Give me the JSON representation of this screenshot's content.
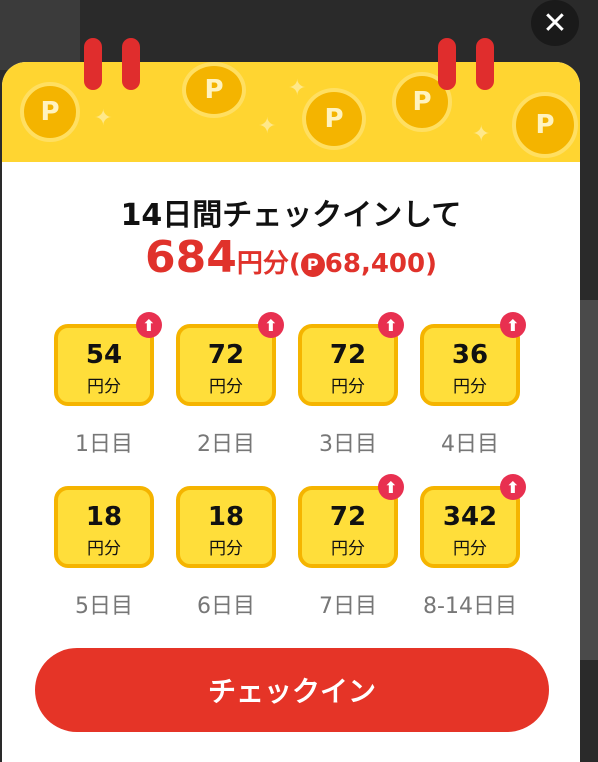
{
  "close_button": {
    "icon": "close-icon",
    "glyph": "✕"
  },
  "header": {
    "coin_glyph": "P",
    "sparkle_glyph": "✦"
  },
  "title": "14日間チェックインして",
  "amount": {
    "value": "684",
    "unit": "円分",
    "open_paren": "(",
    "points_icon": "P",
    "points": "68,400",
    "close_paren": ")"
  },
  "days": [
    {
      "value": "54",
      "unit": "円分",
      "label": "1日目",
      "boosted": true
    },
    {
      "value": "72",
      "unit": "円分",
      "label": "2日目",
      "boosted": true
    },
    {
      "value": "72",
      "unit": "円分",
      "label": "3日目",
      "boosted": true
    },
    {
      "value": "36",
      "unit": "円分",
      "label": "4日目",
      "boosted": true
    },
    {
      "value": "18",
      "unit": "円分",
      "label": "5日目",
      "boosted": false
    },
    {
      "value": "18",
      "unit": "円分",
      "label": "6日目",
      "boosted": false
    },
    {
      "value": "72",
      "unit": "円分",
      "label": "7日目",
      "boosted": true
    },
    {
      "value": "342",
      "unit": "円分",
      "label": "8-14日目",
      "boosted": true
    }
  ],
  "up_glyph": "⬆",
  "checkin_button": {
    "label": "チェックイン"
  },
  "colors": {
    "accent_red": "#e53427",
    "header_yellow": "#ffd531",
    "card_yellow": "#ffde3a",
    "card_border": "#f5b400",
    "badge_pink": "#e83050"
  }
}
